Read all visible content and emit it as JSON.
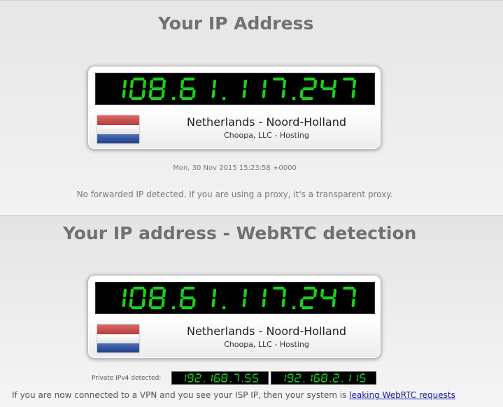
{
  "section1": {
    "heading": "Your IP Address",
    "ip": "108.61.117.247",
    "location": "Netherlands - Noord-Holland",
    "isp": "Choopa, LLC - Hosting",
    "timestamp": "Mon, 30 Nov 2015 15:23:58 +0000",
    "forwarded_note": "No forwarded IP detected. If you are using a proxy, it's a transparent proxy."
  },
  "section2": {
    "heading": "Your IP address - WebRTC detection",
    "ip": "108.61.117.247",
    "location": "Netherlands - Noord-Holland",
    "isp": "Choopa, LLC - Hosting",
    "private_label": "Private IPv4 detected:",
    "private_ips": [
      "192.168.7.55",
      "192.168.2.115"
    ],
    "vpn_note_text": "If you are now connected to a VPN and you see your ISP IP, then your system is ",
    "vpn_link_text": "leaking WebRTC requests"
  },
  "colors": {
    "led_green": "#19d119",
    "led_background": "#000000",
    "heading_gray": "#717171",
    "link_blue": "#1a1a9e"
  },
  "icons": {
    "flag": "netherlands-flag-icon"
  }
}
